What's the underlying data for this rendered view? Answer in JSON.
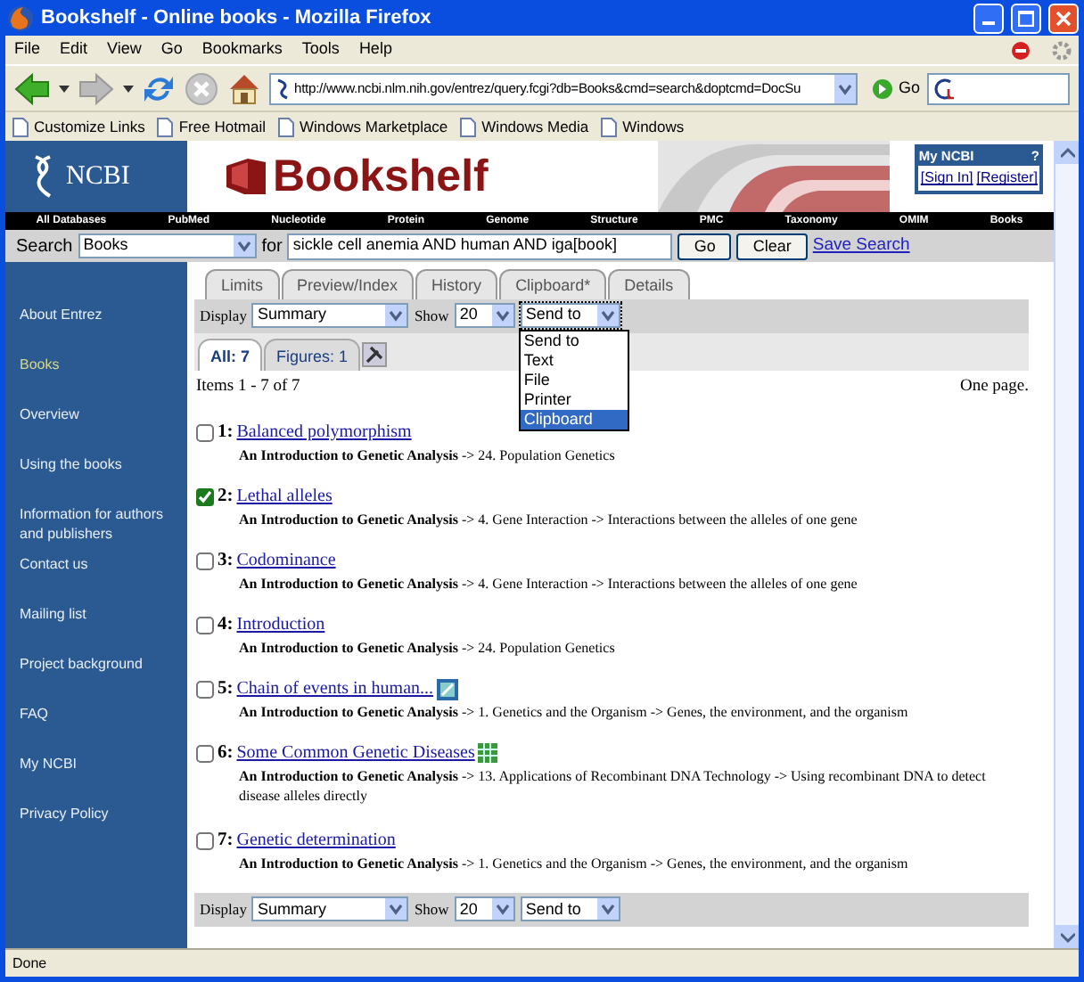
{
  "window": {
    "title": "Bookshelf - Online books - Mozilla Firefox"
  },
  "menu": [
    "File",
    "Edit",
    "View",
    "Go",
    "Bookmarks",
    "Tools",
    "Help"
  ],
  "toolbar": {
    "url": "http://www.ncbi.nlm.nih.gov/entrez/query.fcgi?db=Books&cmd=search&doptcmd=DocSu",
    "go": "Go"
  },
  "bookmarks": [
    "Customize Links",
    "Free Hotmail",
    "Windows Marketplace",
    "Windows Media",
    "Windows"
  ],
  "header": {
    "logo": "NCBI",
    "banner": "Bookshelf",
    "my_ncbi": {
      "title": "My NCBI",
      "help": "?",
      "links": [
        "[Sign In]",
        "[Register]"
      ]
    }
  },
  "databases": [
    "All Databases",
    "PubMed",
    "Nucleotide",
    "Protein",
    "Genome",
    "Structure",
    "PMC",
    "Taxonomy",
    "OMIM",
    "Books"
  ],
  "search": {
    "label": "Search",
    "database": "Books",
    "for": "for",
    "query": "sickle cell anemia AND human AND iga[book]",
    "buttons": [
      "Go",
      "Clear"
    ],
    "save": "Save Search"
  },
  "sidebar": [
    {
      "label": "About Entrez",
      "selected": false
    },
    {
      "label": "Books",
      "selected": true
    },
    {
      "label": "Overview",
      "selected": false
    },
    {
      "label": "Using the books",
      "selected": false
    },
    {
      "label": "Information for authors and publishers",
      "selected": false
    },
    {
      "label": "Contact us",
      "selected": false
    },
    {
      "label": "Mailing list",
      "selected": false
    },
    {
      "label": "Project background",
      "selected": false
    },
    {
      "label": "FAQ",
      "selected": false
    },
    {
      "label": "My NCBI",
      "selected": false
    },
    {
      "label": "Privacy Policy",
      "selected": false
    }
  ],
  "tabs": [
    "Limits",
    "Preview/Index",
    "History",
    "Clipboard*",
    "Details"
  ],
  "display_bar": {
    "display_label": "Display",
    "display": "Summary",
    "show_label": "Show",
    "show": "20",
    "send_to": "Send to",
    "send_to_options": [
      {
        "label": "Send to",
        "selected": false
      },
      {
        "label": "Text",
        "selected": false
      },
      {
        "label": "File",
        "selected": false
      },
      {
        "label": "Printer",
        "selected": false
      },
      {
        "label": "Clipboard",
        "selected": true
      }
    ]
  },
  "result_tabs": [
    {
      "label": "All: 7",
      "selected": true
    },
    {
      "label": "Figures: 1",
      "selected": false
    }
  ],
  "items_count": "Items 1 - 7 of 7",
  "pages": "One page.",
  "results": [
    {
      "number": "1:",
      "title": "Balanced polymorphism",
      "checked": false,
      "source": "**An Introduction to Genetic Analysis** -> 24. Population Genetics"
    },
    {
      "number": "2:",
      "title": "Lethal alleles",
      "checked": true,
      "source": "**An Introduction to Genetic Analysis** -> 4. Gene Interaction -> Interactions between the alleles of one gene"
    },
    {
      "number": "3:",
      "title": "Codominance",
      "checked": false,
      "source": "**An Introduction to Genetic Analysis** -> 4. Gene Interaction -> Interactions between the alleles of one gene"
    },
    {
      "number": "4:",
      "title": "Introduction",
      "checked": false,
      "source": "**An Introduction to Genetic Analysis** -> 24. Population Genetics"
    },
    {
      "number": "5:",
      "title": "Chain of events in human...",
      "checked": false,
      "kind": "figure",
      "source": "**An Introduction to Genetic Analysis** -> 1. Genetics and the Organism -> Genes, the environment, and the organism"
    },
    {
      "number": "6:",
      "title": "Some Common Genetic Diseases",
      "checked": false,
      "kind": "table",
      "source": "**An Introduction to Genetic Analysis** -> 13. Applications of Recombinant DNA Technology -> Using recombinant DNA to detect disease alleles directly"
    },
    {
      "number": "7:",
      "title": "Genetic determination",
      "checked": false,
      "source": "**An Introduction to Genetic Analysis** -> 1. Genetics and the Organism -> Genes, the environment, and the organism"
    }
  ],
  "bottom_bar": {
    "display_label": "Display",
    "display": "Summary",
    "show_label": "Show",
    "show": "20",
    "send_to": "Send to"
  },
  "status_bar": "Done"
}
